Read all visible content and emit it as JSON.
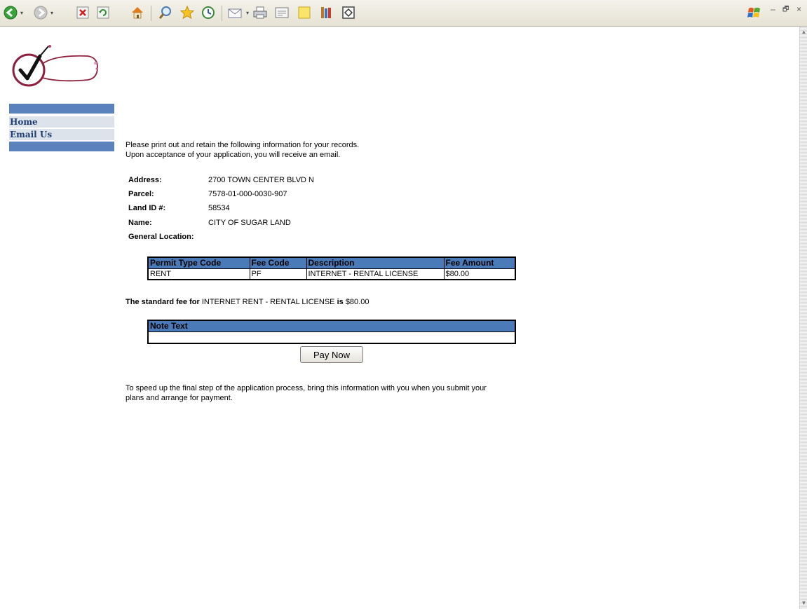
{
  "toolbar": {
    "icons": [
      "back-icon",
      "forward-icon",
      "stop-icon",
      "refresh-icon",
      "home-icon",
      "search-icon",
      "favorites-icon",
      "history-icon",
      "mail-icon",
      "print-icon",
      "edit-icon",
      "notes-icon",
      "research-icon",
      "messenger-icon"
    ],
    "window_controls": {
      "minimize": "–",
      "restore": "🗗",
      "close": "×"
    }
  },
  "nav": {
    "items": [
      {
        "label": "Home"
      },
      {
        "label": "Email Us"
      }
    ],
    "bar_color": "#5b82bd"
  },
  "intro": {
    "line1": "Please print out and retain the following information for your records.",
    "line2": "Upon acceptance of your application, you will receive an email."
  },
  "details": {
    "address_label": "Address:",
    "address": "2700 TOWN CENTER BLVD N",
    "parcel_label": "Parcel:",
    "parcel": "7578-01-000-0030-907",
    "land_id_label": "Land ID #:",
    "land_id": "58534",
    "name_label": "Name:",
    "name": "CITY OF SUGAR LAND",
    "general_location_label": "General Location:",
    "general_location": ""
  },
  "fee_table": {
    "headers": [
      "Permit Type Code",
      "Fee Code",
      "Description",
      "Fee Amount"
    ],
    "rows": [
      [
        "RENT",
        "PF",
        "INTERNET - RENTAL LICENSE",
        "$80.00"
      ]
    ],
    "header_color": "#4a7ab8"
  },
  "standard_fee": {
    "prefix": "The standard fee for",
    "item": "INTERNET RENT - RENTAL LICENSE",
    "is": "is",
    "amount": "$80.00"
  },
  "note_table": {
    "header": "Note Text",
    "value": ""
  },
  "pay_button": "Pay Now",
  "footer": {
    "line1": "To speed up the final step of the application process, bring this information with you when you submit your",
    "line2": "plans and arrange for payment."
  }
}
